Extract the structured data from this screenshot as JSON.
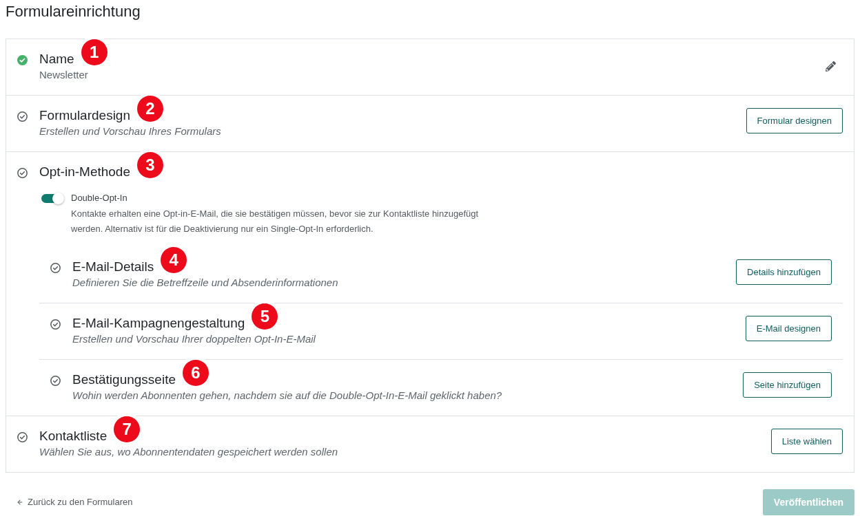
{
  "page_title": "Formulareinrichtung",
  "steps": [
    {
      "title": "Name",
      "value": "Newsletter",
      "completed": true,
      "marker": "1",
      "action": {
        "kind": "edit"
      }
    },
    {
      "title": "Formulardesign",
      "description": "Erstellen und Vorschau Ihres Formulars",
      "completed": false,
      "marker": "2",
      "action": {
        "kind": "button",
        "label": "Formular designen"
      }
    },
    {
      "title": "Opt-in-Methode",
      "completed": false,
      "marker": "3",
      "toggle": {
        "label": "Double-Opt-In",
        "on": true,
        "description": "Kontakte erhalten eine Opt-in-E-Mail, die sie bestätigen müssen, bevor sie zur Kontaktliste hinzugefügt werden. Alternativ ist für die Deaktivierung nur ein Single-Opt-In erforderlich."
      },
      "children": [
        {
          "title": "E-Mail-Details",
          "description": "Definieren Sie die Betreffzeile und Absenderinformationen",
          "completed": false,
          "marker": "4",
          "action": {
            "kind": "button",
            "label": "Details hinzufügen"
          }
        },
        {
          "title": "E-Mail-Kampagnengestaltung",
          "description": "Erstellen und Vorschau Ihrer doppelten Opt-In-E-Mail",
          "completed": false,
          "marker": "5",
          "action": {
            "kind": "button",
            "label": "E-Mail designen"
          }
        },
        {
          "title": "Bestätigungsseite",
          "description": "Wohin werden Abonnenten gehen, nachdem sie auf die Double-Opt-In-E-Mail geklickt haben?",
          "completed": false,
          "marker": "6",
          "action": {
            "kind": "button",
            "label": "Seite hinzufügen"
          }
        }
      ]
    },
    {
      "title": "Kontaktliste",
      "description": "Wählen Sie aus, wo Abonnentendaten gespeichert werden sollen",
      "completed": false,
      "marker": "7",
      "action": {
        "kind": "button",
        "label": "Liste wählen"
      }
    }
  ],
  "footer": {
    "back_link": "Zurück zu den Formularen",
    "publish_button": {
      "label": "Veröffentlichen",
      "disabled": true
    }
  }
}
